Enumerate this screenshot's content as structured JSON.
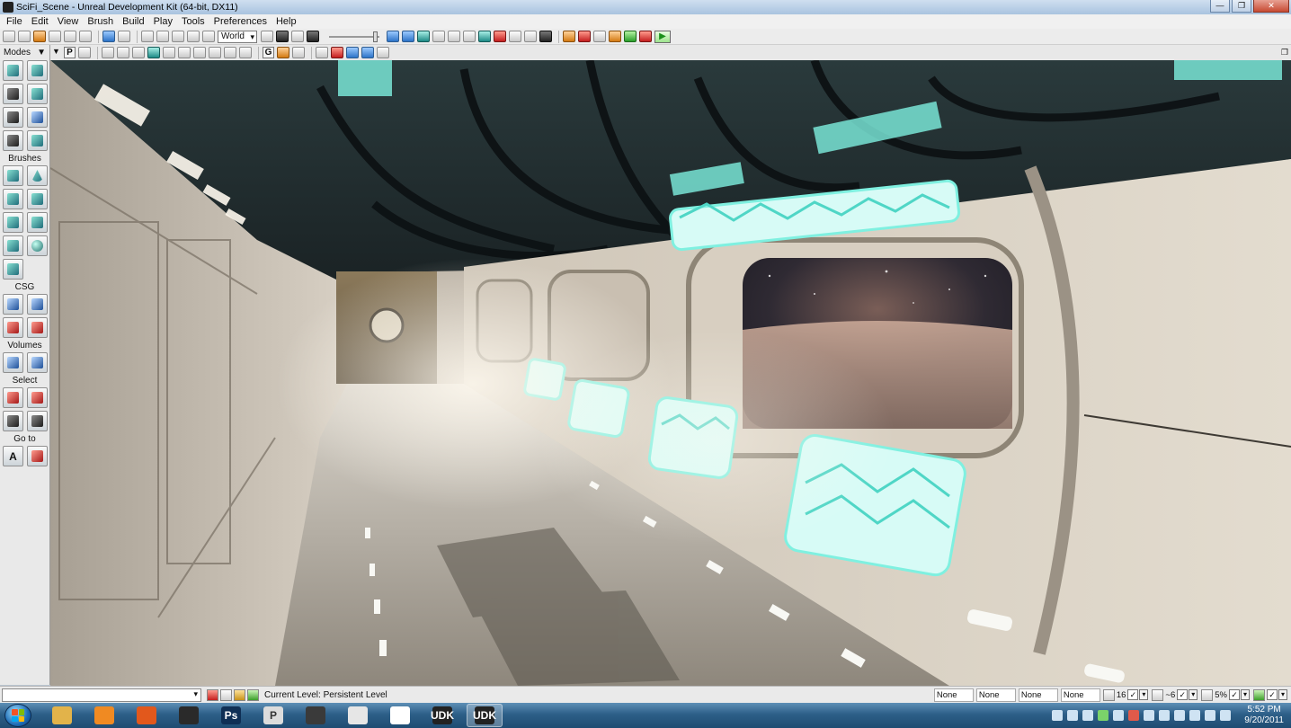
{
  "window": {
    "title": "SciFi_Scene - Unreal Development Kit (64-bit, DX11)",
    "minimize": "—",
    "maximize": "❐",
    "close": "✕"
  },
  "menu": [
    "File",
    "Edit",
    "View",
    "Brush",
    "Build",
    "Play",
    "Tools",
    "Preferences",
    "Help"
  ],
  "toolbar": {
    "coord_system": "World"
  },
  "viewport_toolbar": {
    "perspective_label": "P",
    "game_view_label": "G"
  },
  "modes_panel": {
    "title": "Modes",
    "sections": {
      "brushes": "Brushes",
      "csg": "CSG",
      "volumes": "Volumes",
      "select": "Select",
      "goto": "Go to"
    },
    "goto_actor_label": "A"
  },
  "status_bar": {
    "command_value": "",
    "current_level": "Current Level:  Persistent Level",
    "fields": [
      "None",
      "None",
      "None",
      "None"
    ],
    "grid_size": "16",
    "rotation_snap": "~6",
    "scale_snap": "5%"
  },
  "taskbar": {
    "apps": [
      {
        "name": "explorer",
        "label": "",
        "color": "#e2b34a"
      },
      {
        "name": "media-player",
        "label": "",
        "color": "#f08a22"
      },
      {
        "name": "firefox",
        "label": "",
        "color": "#e2581c"
      },
      {
        "name": "unity",
        "label": "",
        "color": "#2a2a2a"
      },
      {
        "name": "photoshop",
        "label": "Ps",
        "color": "#0f2f55"
      },
      {
        "name": "perforce",
        "label": "P",
        "color": "#dcdcdc"
      },
      {
        "name": "app-7",
        "label": "",
        "color": "#3a3a3a"
      },
      {
        "name": "app-8",
        "label": "",
        "color": "#e6e6e6"
      },
      {
        "name": "app-9",
        "label": "",
        "color": "#ffffff"
      },
      {
        "name": "udk-1",
        "label": "UDK",
        "color": "#222222"
      },
      {
        "name": "udk-2",
        "label": "UDK",
        "color": "#222222"
      }
    ],
    "active_app_index": 10,
    "clock_time": "5:52 PM",
    "clock_date": "9/20/2011"
  },
  "colors": {
    "accent_teal": "#7ff0e0",
    "window_blue": "#a9c3df",
    "taskbar_blue": "#2d5f88"
  }
}
